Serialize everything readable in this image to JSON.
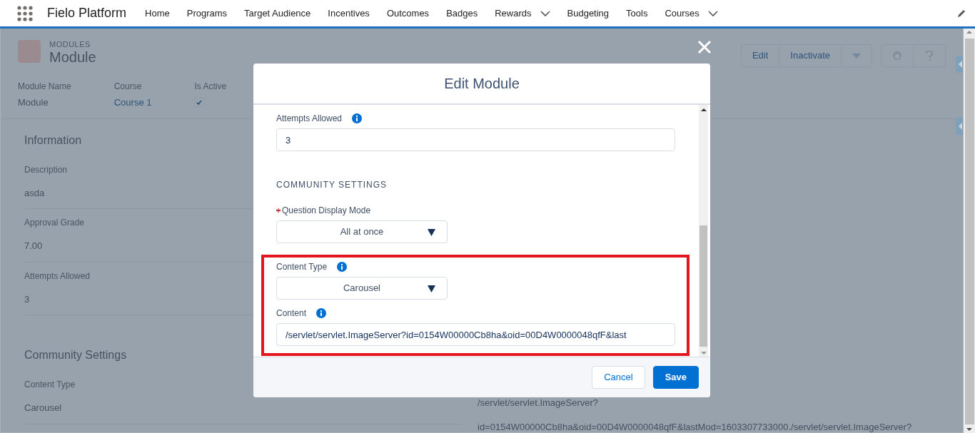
{
  "app": {
    "name": "Fielo Platform"
  },
  "nav": [
    {
      "label": "Home",
      "dropdown": false
    },
    {
      "label": "Programs",
      "dropdown": false
    },
    {
      "label": "Target Audience",
      "dropdown": false
    },
    {
      "label": "Incentives",
      "dropdown": false
    },
    {
      "label": "Outcomes",
      "dropdown": false
    },
    {
      "label": "Badges",
      "dropdown": false
    },
    {
      "label": "Rewards",
      "dropdown": true
    },
    {
      "label": "Budgeting",
      "dropdown": false
    },
    {
      "label": "Tools",
      "dropdown": false
    },
    {
      "label": "Courses",
      "dropdown": true
    }
  ],
  "record": {
    "object": "MODULES",
    "title": "Module",
    "actions": [
      "Edit",
      "Inactivate"
    ],
    "highlights": [
      {
        "kind": "text",
        "label": "Module Name",
        "value": "Module"
      },
      {
        "kind": "link",
        "label": "Course",
        "value": "Course 1"
      },
      {
        "kind": "checkbox",
        "label": "Is Active",
        "checked": true
      }
    ]
  },
  "sections": [
    {
      "title": "Information",
      "fields": [
        {
          "label": "Description",
          "value": "asda"
        },
        {
          "label": "Approval Grade",
          "value": "7.00"
        },
        {
          "label": "Attempts Allowed",
          "value": "3"
        }
      ]
    },
    {
      "title": "Community Settings",
      "fields": [
        {
          "label": "Content Type",
          "value": "Carousel"
        }
      ],
      "right_value_lines": [
        "/servlet/servlet.ImageServer?",
        "id=0154W00000Cb8ha&oid=00D4W0000048qfF&lastMod=1603307733000./servlet/servlet.ImageServer?"
      ]
    }
  ],
  "modal": {
    "title": "Edit Module",
    "fields": [
      {
        "kind": "input",
        "label": "Attempts Allowed",
        "info": true,
        "required": false,
        "highlighted": false,
        "value": "3"
      },
      {
        "kind": "heading",
        "label": "COMMUNITY SETTINGS"
      },
      {
        "kind": "select",
        "label": "Question Display Mode",
        "info": false,
        "required": true,
        "highlighted": false,
        "value": "All at once"
      },
      {
        "kind": "select",
        "label": "Content Type",
        "info": true,
        "required": false,
        "highlighted": true,
        "value": "Carousel"
      },
      {
        "kind": "input",
        "label": "Content",
        "info": true,
        "required": false,
        "highlighted": true,
        "value": "/servlet/servlet.ImageServer?id=0154W00000Cb8ha&oid=00D4W0000048qfF&last"
      }
    ],
    "buttons": [
      {
        "label": "Cancel",
        "kind": "neutral"
      },
      {
        "label": "Save",
        "kind": "brand"
      }
    ]
  }
}
